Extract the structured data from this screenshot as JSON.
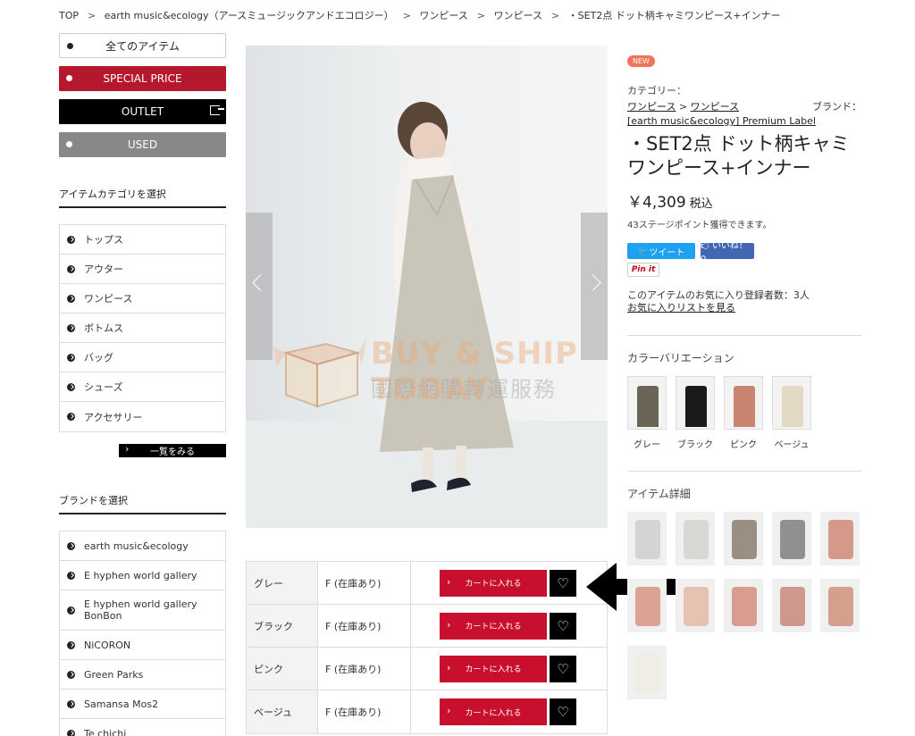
{
  "breadcrumb": [
    "TOP",
    "earth music&ecology（アースミュージックアンドエコロジー）",
    "ワンピース",
    "ワンピース",
    "・SET2点 ドット柄キャミワンピース+インナー"
  ],
  "sidebar": {
    "all_items": "全てのアイテム",
    "special_price": "SPECIAL PRICE",
    "outlet": "OUTLET",
    "used": "USED",
    "category_heading": "アイテムカテゴリを選択",
    "categories": [
      "トップス",
      "アウター",
      "ワンピース",
      "ボトムス",
      "バッグ",
      "シューズ",
      "アクセサリー"
    ],
    "view_all": "一覧をみる",
    "brand_heading": "ブランドを選択",
    "brands": [
      "earth music&ecology",
      "E hyphen world gallery",
      "E hyphen world gallery BonBon",
      "NiCORON",
      "Green Parks",
      "Samansa Mos2",
      "Te chichi"
    ]
  },
  "watermark": {
    "title": "BUY & SHIP TODAY",
    "subtitle": "國際網購轉運服務"
  },
  "variants": [
    {
      "color": "グレー",
      "size": "F (在庫あり)",
      "cart": "カートに入れる"
    },
    {
      "color": "ブラック",
      "size": "F (在庫あり)",
      "cart": "カートに入れる"
    },
    {
      "color": "ピンク",
      "size": "F (在庫あり)",
      "cart": "カートに入れる"
    },
    {
      "color": "ベージュ",
      "size": "F (在庫あり)",
      "cart": "カートに入れる"
    }
  ],
  "product": {
    "badge": "NEW",
    "category_label": "カテゴリー：",
    "category_link1": "ワンピース",
    "category_sep": " > ",
    "category_link2": "ワンピース",
    "brand_label": "ブランド：",
    "brand_link": "[earth music&ecology] Premium Label",
    "title": "・SET2点 ドット柄キャミワンピース+インナー",
    "price": "￥4,309",
    "tax": "税込",
    "points": "43ステージポイント獲得できます。",
    "tweet": "ツイート",
    "like": "🖒 いいね！ 0",
    "pinit": "Pin it",
    "fav_count": "このアイテムのお気に入り登録者数：3人",
    "fav_link": "お気に入りリストを見る",
    "color_heading": "カラーバリエーション",
    "colors": [
      {
        "label": "グレー",
        "swatch": "#6b6557"
      },
      {
        "label": "ブラック",
        "swatch": "#1a1a1a"
      },
      {
        "label": "ピンク",
        "swatch": "#c9846f"
      },
      {
        "label": "ベージュ",
        "swatch": "#e3d8c4"
      }
    ],
    "detail_heading": "アイテム詳細",
    "detail_thumbs": [
      "#cfcfcf",
      "#d6d4cf",
      "#8c7d6e",
      "#7f7f7f",
      "#cf8a77",
      "#d69582",
      "#e5b8a7",
      "#d38e7c",
      "#c88a7a",
      "#d0907c",
      "#f1ebe3"
    ]
  },
  "colors": {
    "accent_red": "#c8102e",
    "special_price": "#b5182c",
    "twitter": "#1da1f2",
    "facebook": "#4267b2"
  }
}
